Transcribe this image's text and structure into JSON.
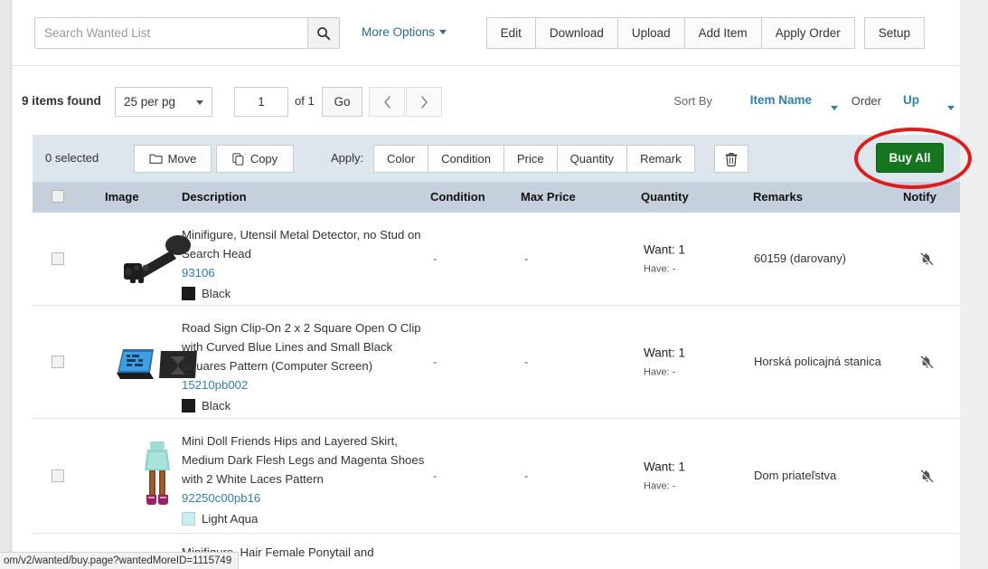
{
  "search": {
    "placeholder": "Search Wanted List",
    "value": "",
    "icon": "search-icon",
    "more_options_label": "More Options"
  },
  "toolbar": {
    "buttons": [
      {
        "label": "Edit"
      },
      {
        "label": "Download"
      },
      {
        "label": "Upload"
      },
      {
        "label": "Add Item"
      },
      {
        "label": "Apply Order"
      },
      {
        "label": "Setup"
      }
    ]
  },
  "pagination": {
    "items_found": "9 items found",
    "per_page": "25 per pg",
    "page_number": "1",
    "of_total": "of 1",
    "go_label": "Go",
    "prev_icon": "chevron-left-icon",
    "next_icon": "chevron-right-icon"
  },
  "sorting": {
    "sort_by_label": "Sort By",
    "sort_by_value": "Item Name",
    "order_label": "Order",
    "order_value": "Up",
    "link_color": "#2e7fb0"
  },
  "action_bar": {
    "selected_count": "0 selected",
    "move_label": "Move",
    "move_icon": "folder-icon",
    "copy_label": "Copy",
    "copy_icon": "copy-icon",
    "apply_label": "Apply:",
    "apply_options": [
      "Color",
      "Condition",
      "Price",
      "Quantity",
      "Remark"
    ],
    "delete_icon": "trash-icon",
    "buy_all_label": "Buy All",
    "buy_all_color": "#15761f",
    "bar_color": "#dde5ed",
    "annotation": {
      "shape": "red-ellipse",
      "color": "#e01b1b",
      "targets": "buy-all-button"
    }
  },
  "table": {
    "header_bg": "#c6d0dc",
    "columns": [
      {
        "key": "checkbox",
        "label": ""
      },
      {
        "key": "image",
        "label": "Image"
      },
      {
        "key": "description",
        "label": "Description"
      },
      {
        "key": "condition",
        "label": "Condition"
      },
      {
        "key": "max_price",
        "label": "Max Price"
      },
      {
        "key": "quantity",
        "label": "Quantity"
      },
      {
        "key": "remarks",
        "label": "Remarks"
      },
      {
        "key": "notify",
        "label": "Notify"
      }
    ],
    "rows": [
      {
        "description": "Minifigure, Utensil Metal Detector, no Stud on Search Head",
        "part_no": "93106",
        "color_name": "Black",
        "color_hex": "#1b1b1b",
        "condition": "-",
        "max_price": "-",
        "want": "Want: 1",
        "have": "Have: -",
        "remarks": "60159 (darovany)",
        "notify_icon": "bell-off-icon",
        "image_name": "metal-detector-part-image"
      },
      {
        "description": "Road Sign Clip-On 2 x 2 Square Open O Clip with Curved Blue Lines and Small Black Squares Pattern (Computer Screen)",
        "part_no": "15210pb002",
        "color_name": "Black",
        "color_hex": "#1b1b1b",
        "condition": "-",
        "max_price": "-",
        "want": "Want: 1",
        "have": "Have: -",
        "remarks": "Horská policajná stanica",
        "notify_icon": "bell-off-icon",
        "image_name": "road-sign-part-image"
      },
      {
        "description": "Mini Doll Friends Hips and Layered Skirt, Medium Dark Flesh Legs and Magenta Shoes with 2 White Laces Pattern",
        "part_no": "92250c00pb16",
        "color_name": "Light Aqua",
        "color_hex": "#c8f0f0",
        "condition": "-",
        "max_price": "-",
        "want": "Want: 1",
        "have": "Have: -",
        "remarks": "Dom priateľstva",
        "notify_icon": "bell-off-icon",
        "image_name": "mini-doll-part-image"
      },
      {
        "description": "Minifigure, Hair Female Ponytail and",
        "part_no": "",
        "color_name": "",
        "color_hex": "",
        "condition": "",
        "max_price": "",
        "want": "",
        "have": "",
        "remarks": "",
        "notify_icon": "",
        "image_name": ""
      }
    ]
  },
  "status_bar": {
    "url": "om/v2/wanted/buy.page?wantedMoreID=1115749"
  }
}
